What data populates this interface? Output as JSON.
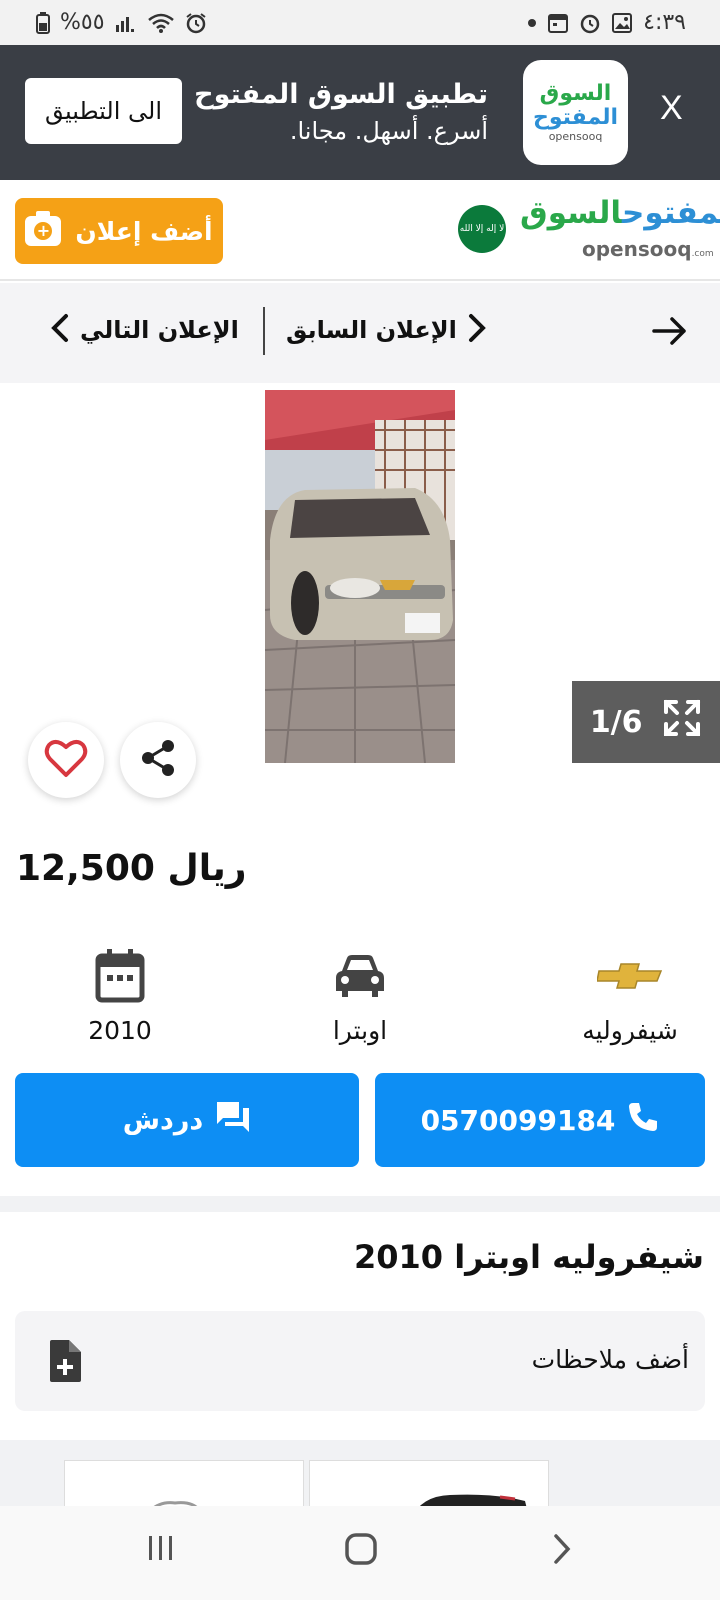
{
  "status_bar": {
    "battery": "%٥٥",
    "time": "٤:٣٩",
    "icons": [
      "battery-icon",
      "signal-icon",
      "wifi-icon",
      "alarm-icon",
      "dot-icon",
      "calendar-icon",
      "alarm-icon",
      "gallery-icon"
    ]
  },
  "app_banner": {
    "open_app_label": "الى التطبيق",
    "title": "تطبيق السوق المفتوح",
    "subtitle": "أسرع. أسهل. مجانا.",
    "logo_line1": "السوق",
    "logo_line2": "المفتوح",
    "logo_line3": "opensooq",
    "close_label": "X"
  },
  "header": {
    "post_ad_label": "أضف إعلان",
    "brand_ar_green": "السوق",
    "brand_ar_blue": "المفتوح",
    "brand_en": "opensooq",
    "brand_en_suffix": ".com",
    "flag_text": "لا إله إلا الله"
  },
  "ad_nav": {
    "previous_label": "الإعلان السابق",
    "next_label": "الإعلان التالي"
  },
  "gallery": {
    "counter": "1/6",
    "current_image": 1,
    "total_images": 6
  },
  "listing": {
    "price_value": "12,500",
    "price_currency": "ريال",
    "specs": {
      "make": "شيفروليه",
      "model": "اوبترا",
      "year": "2010"
    },
    "phone": "0570099184",
    "chat_label": "دردش",
    "title": "شيفروليه اوبترا 2010",
    "add_notes_label": "أضف ملاحظات"
  },
  "colors": {
    "accent_blue": "#0d8ef4",
    "post_ad_orange": "#f5a116",
    "banner_bg": "#3a3e45",
    "favorite_red": "#d7373f"
  }
}
